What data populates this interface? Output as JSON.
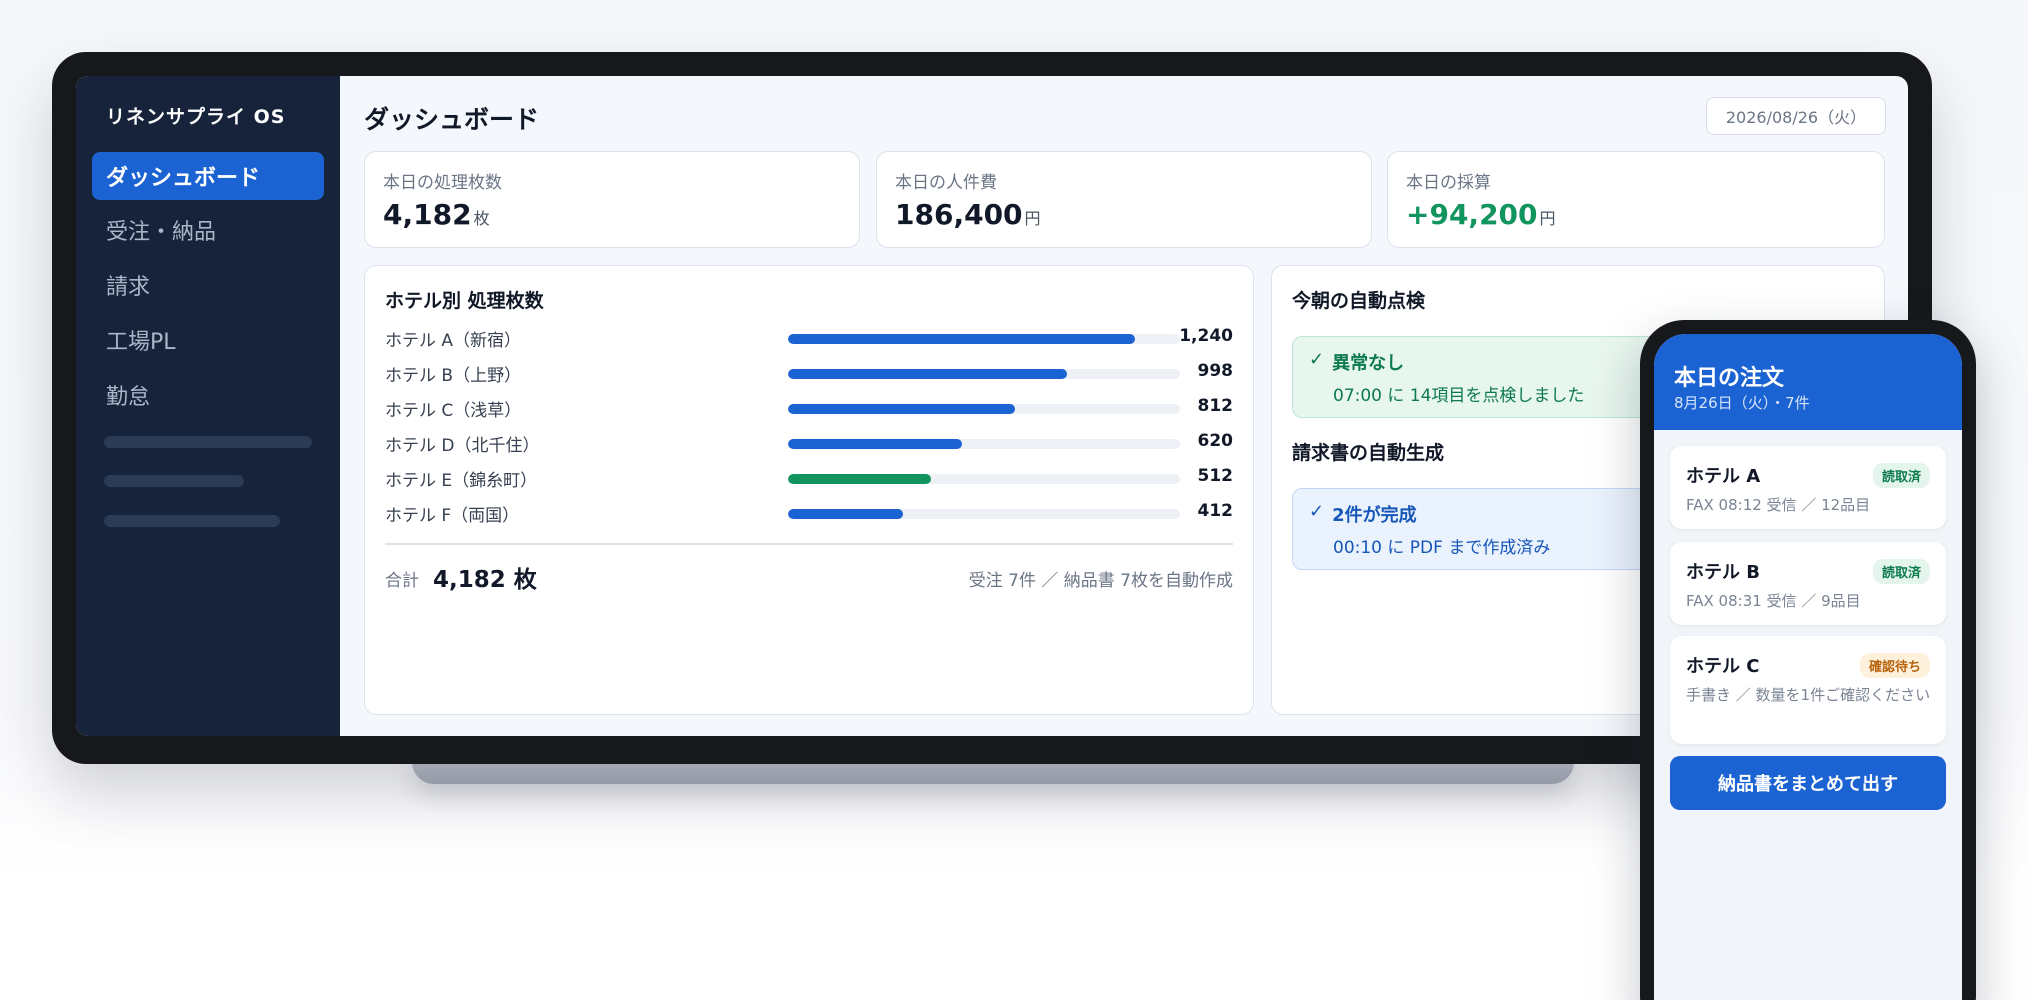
{
  "sidebar": {
    "brand": "リネンサプライ OS",
    "items": [
      {
        "label": "ダッシュボード"
      },
      {
        "label": "受注・納品"
      },
      {
        "label": "請求"
      },
      {
        "label": "工場PL"
      },
      {
        "label": "勤怠"
      }
    ]
  },
  "header": {
    "title": "ダッシュボード",
    "date": "2026/08/26（火）"
  },
  "kpis": [
    {
      "label": "本日の処理枚数",
      "value": "4,182",
      "unit": "枚"
    },
    {
      "label": "本日の人件費",
      "value": "186,400",
      "unit": "円"
    },
    {
      "label": "本日の採算",
      "value": "+94,200",
      "unit": "円"
    }
  ],
  "hotel_chart": {
    "title": "ホテル別 処理枚数",
    "rows": [
      {
        "label": "ホテル A（新宿）",
        "value": 1240,
        "display": "1,240"
      },
      {
        "label": "ホテル B（上野）",
        "value": 998,
        "display": "998"
      },
      {
        "label": "ホテル C（浅草）",
        "value": 812,
        "display": "812"
      },
      {
        "label": "ホテル D（北千住）",
        "value": 620,
        "display": "620"
      },
      {
        "label": "ホテル E（錦糸町）",
        "value": 512,
        "display": "512",
        "highlight": true
      },
      {
        "label": "ホテル F（両国）",
        "value": 412,
        "display": "412"
      }
    ],
    "bar_max": 1400,
    "total_label": "合計",
    "total_value": "4,182 枚",
    "total_note": "受注 7件 ／ 納品書 7枚を自動作成"
  },
  "auto_check": {
    "title": "今朝の自動点検",
    "status": "異常なし",
    "detail": "07:00 に 14項目を点検しました"
  },
  "auto_invoice": {
    "title": "請求書の自動生成",
    "status": "2件が完成",
    "detail": "00:10 に PDF まで作成済み"
  },
  "check_icon": "✓",
  "phone": {
    "title": "本日の注文",
    "subtitle": "8月26日（火）・7件",
    "orders": [
      {
        "name": "ホテル A",
        "badge": "読取済",
        "detail": "FAX 08:12 受信 ／ 12品目"
      },
      {
        "name": "ホテル B",
        "badge": "読取済",
        "detail": "FAX 08:31 受信 ／ 9品目"
      },
      {
        "name": "ホテル C",
        "badge": "確認待ち",
        "detail": "手書き ／ 数量を1件ご確認ください"
      }
    ],
    "button_label": "納品書をまとめて出す"
  },
  "colors": {
    "accent": "#1b63d2",
    "positive": "#12945f",
    "warning": "#b7630c",
    "sidebar": "#16233a"
  }
}
